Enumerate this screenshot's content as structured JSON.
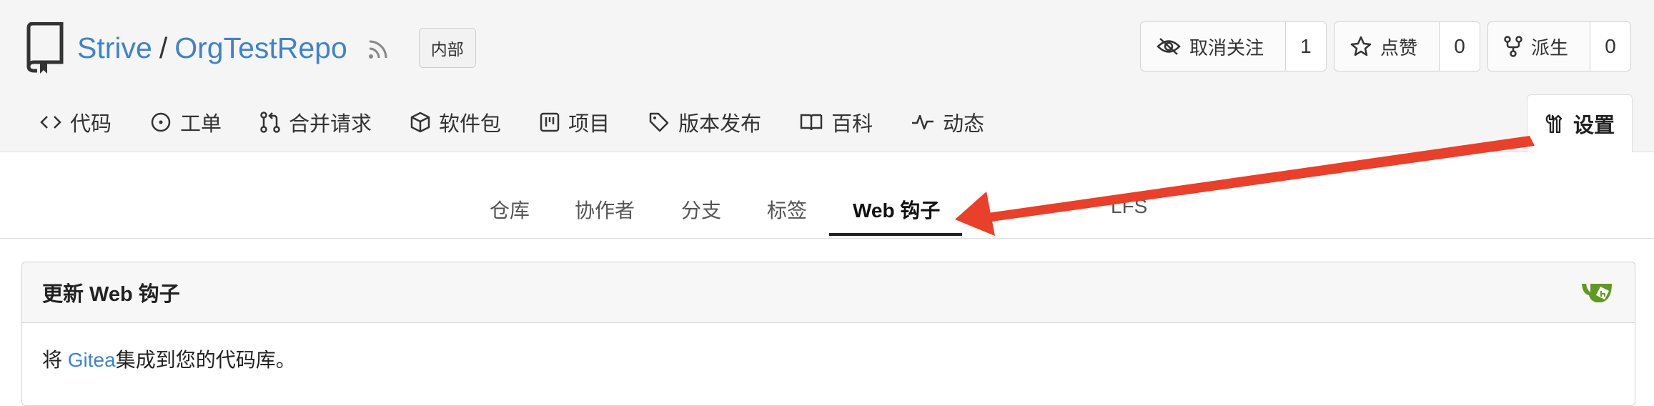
{
  "repo": {
    "owner": "Strive",
    "separator": "/",
    "name": "OrgTestRepo",
    "visibility_badge": "内部"
  },
  "actions": {
    "watch": {
      "label": "取消关注",
      "count": "1"
    },
    "star": {
      "label": "点赞",
      "count": "0"
    },
    "fork": {
      "label": "派生",
      "count": "0"
    }
  },
  "nav": {
    "code": "代码",
    "issues": "工单",
    "pulls": "合并请求",
    "packages": "软件包",
    "projects": "项目",
    "releases": "版本发布",
    "wiki": "百科",
    "activity": "动态",
    "settings": "设置"
  },
  "settings_nav": {
    "repository": "仓库",
    "collaborators": "协作者",
    "branches": "分支",
    "tags": "标签",
    "webhooks": "Web 钩子",
    "lfs": "LFS"
  },
  "panel": {
    "title": "更新 Web 钩子",
    "text_prefix": "将 ",
    "link": "Gitea",
    "text_suffix": "集成到您的代码库。"
  },
  "colors": {
    "link": "#4183c4",
    "arrow": "#e8402a",
    "gitea_green": "#609926"
  }
}
